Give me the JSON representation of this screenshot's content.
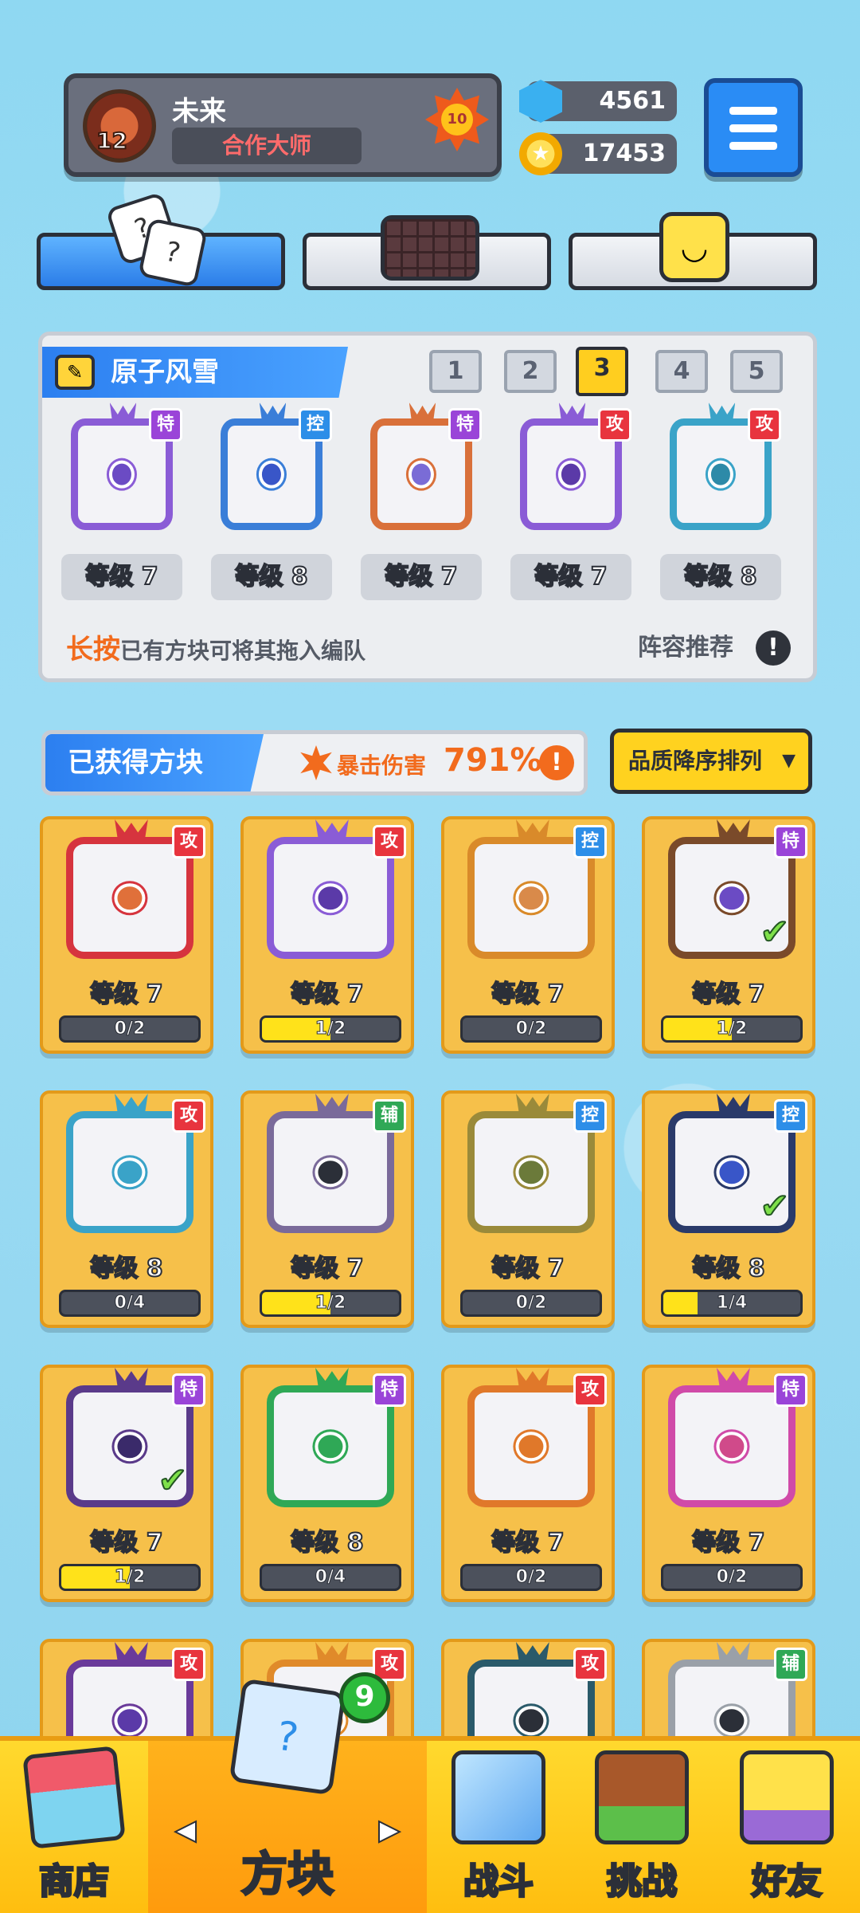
{
  "player": {
    "level": "12",
    "name": "未来",
    "title": "合作大师",
    "rank_badge": "10"
  },
  "currency": {
    "gems": "4561",
    "coins": "17453"
  },
  "team": {
    "name": "原子风雪",
    "slots": [
      "1",
      "2",
      "3",
      "4",
      "5"
    ],
    "active_slot": "3",
    "members": [
      {
        "tag": "特",
        "tag_type": "spc",
        "level": "等级 7",
        "color": "#8a5cd6",
        "dot": "#6b4bc4"
      },
      {
        "tag": "控",
        "tag_type": "ctl",
        "level": "等级 8",
        "color": "#3a7ed8",
        "dot": "#3956c8"
      },
      {
        "tag": "特",
        "tag_type": "spc",
        "level": "等级 7",
        "color": "#d9703a",
        "dot": "#7a6cd6"
      },
      {
        "tag": "攻",
        "tag_type": "atk",
        "level": "等级 7",
        "color": "#8a5cd6",
        "dot": "#5b3aa8"
      },
      {
        "tag": "攻",
        "tag_type": "atk",
        "level": "等级 8",
        "color": "#3aa3c8",
        "dot": "#2d8aa8"
      }
    ],
    "hint_highlight": "长按",
    "hint_text": "已有方块可将其拖入编队",
    "recommend_label": "阵容推荐",
    "info_symbol": "!"
  },
  "owned": {
    "title": "已获得方块",
    "crit_label": "暴击伤害",
    "crit_value": "791%",
    "info_symbol": "!",
    "sort_label": "品质降序排列",
    "sort_caret": "▼",
    "blocks": [
      {
        "tag": "攻",
        "tag_type": "atk",
        "level": "等级 7",
        "progress_text": "0/2",
        "progress": 0.0,
        "color": "#d6343e",
        "dot": "#e0703a",
        "checked": false
      },
      {
        "tag": "攻",
        "tag_type": "atk",
        "level": "等级 7",
        "progress_text": "1/2",
        "progress": 0.5,
        "color": "#8a5cd6",
        "dot": "#5b3aa8",
        "checked": false
      },
      {
        "tag": "控",
        "tag_type": "ctl",
        "level": "等级 7",
        "progress_text": "0/2",
        "progress": 0.0,
        "color": "#d98a2a",
        "dot": "#d98a4a",
        "checked": false
      },
      {
        "tag": "特",
        "tag_type": "spc",
        "level": "等级 7",
        "progress_text": "1/2",
        "progress": 0.5,
        "color": "#7a4a2a",
        "dot": "#6b4bc4",
        "checked": true
      },
      {
        "tag": "攻",
        "tag_type": "atk",
        "level": "等级 8",
        "progress_text": "0/4",
        "progress": 0.0,
        "color": "#3aa3c8",
        "dot": "#3aa3c8",
        "checked": false
      },
      {
        "tag": "辅",
        "tag_type": "sup",
        "level": "等级 7",
        "progress_text": "1/2",
        "progress": 0.5,
        "color": "#7a6a9a",
        "dot": "#2b2f38",
        "checked": false
      },
      {
        "tag": "控",
        "tag_type": "ctl",
        "level": "等级 7",
        "progress_text": "0/2",
        "progress": 0.0,
        "color": "#9a8a3a",
        "dot": "#6b7a3a",
        "checked": false
      },
      {
        "tag": "控",
        "tag_type": "ctl",
        "level": "等级 8",
        "progress_text": "1/4",
        "progress": 0.25,
        "color": "#2a3a6a",
        "dot": "#3956c8",
        "checked": true
      },
      {
        "tag": "特",
        "tag_type": "spc",
        "level": "等级 7",
        "progress_text": "1/2",
        "progress": 0.5,
        "color": "#5a3a8a",
        "dot": "#3a2a6a",
        "checked": true
      },
      {
        "tag": "特",
        "tag_type": "spc",
        "level": "等级 8",
        "progress_text": "0/4",
        "progress": 0.0,
        "color": "#2fa856",
        "dot": "#2fa856",
        "checked": false
      },
      {
        "tag": "攻",
        "tag_type": "atk",
        "level": "等级 7",
        "progress_text": "0/2",
        "progress": 0.0,
        "color": "#e0782a",
        "dot": "#e0782a",
        "checked": false
      },
      {
        "tag": "特",
        "tag_type": "spc",
        "level": "等级 7",
        "progress_text": "0/2",
        "progress": 0.0,
        "color": "#d04aa8",
        "dot": "#d04a8a",
        "checked": false
      },
      {
        "tag": "攻",
        "tag_type": "atk",
        "level": "",
        "progress_text": "",
        "progress": 0.0,
        "color": "#6a3a9a",
        "dot": "#5b3aa8",
        "checked": false
      },
      {
        "tag": "攻",
        "tag_type": "atk",
        "level": "",
        "progress_text": "",
        "progress": 0.0,
        "color": "#e08a2a",
        "dot": "#e08a2a",
        "checked": false
      },
      {
        "tag": "攻",
        "tag_type": "atk",
        "level": "",
        "progress_text": "",
        "progress": 0.0,
        "color": "#2a5a6a",
        "dot": "#2b2f38",
        "checked": false
      },
      {
        "tag": "辅",
        "tag_type": "sup",
        "level": "",
        "progress_text": "",
        "progress": 0.0,
        "color": "#9aa0a8",
        "dot": "#2b2f38",
        "checked": false
      }
    ]
  },
  "nav": {
    "shop": "商店",
    "blocks": "方块",
    "battle": "战斗",
    "challenge": "挑战",
    "friends": "好友",
    "new_count": "9",
    "arrow_left": "◀",
    "arrow_right": "▶"
  },
  "mode_tabs": {
    "dice_glyph": "?",
    "smile_glyph": "◡"
  }
}
